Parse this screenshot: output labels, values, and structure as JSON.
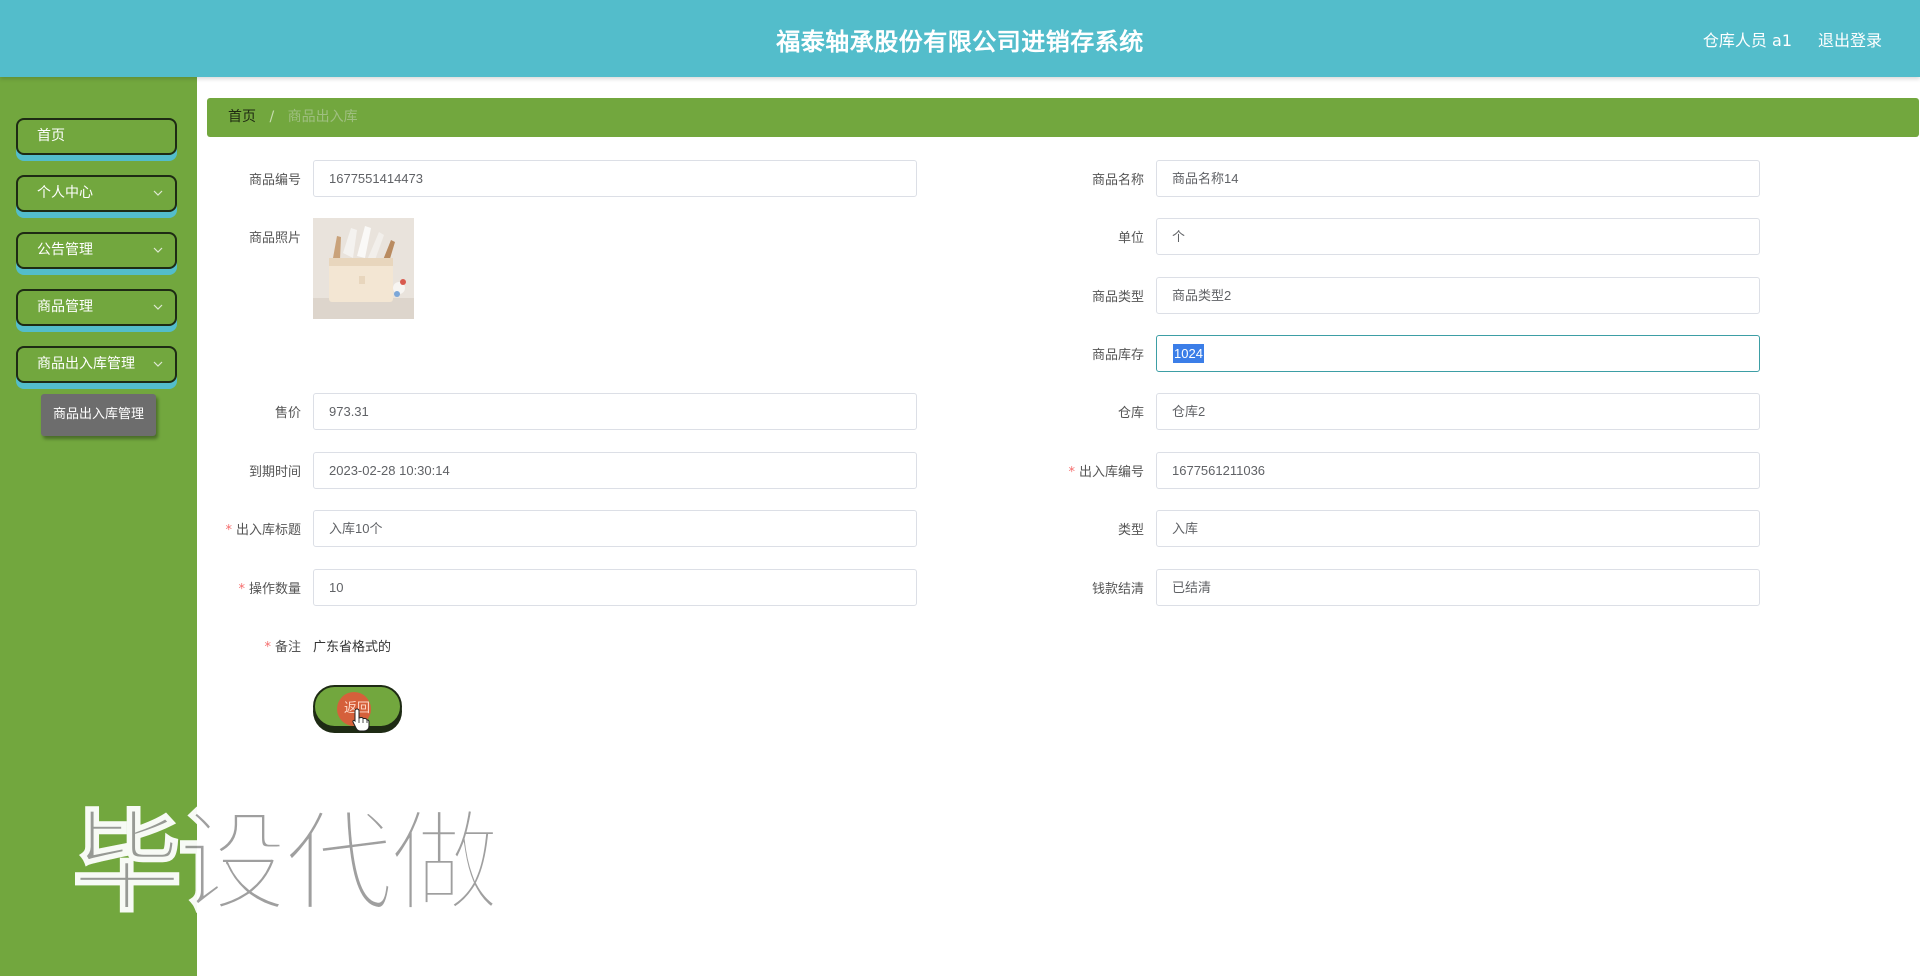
{
  "header": {
    "title": "福泰轴承股份有限公司进销存系统",
    "user": "仓库人员 a1",
    "logout": "退出登录"
  },
  "sidebar": {
    "items": [
      {
        "label": "首页",
        "has_arrow": false
      },
      {
        "label": "个人中心",
        "has_arrow": true
      },
      {
        "label": "公告管理",
        "has_arrow": true
      },
      {
        "label": "商品管理",
        "has_arrow": true
      },
      {
        "label": "商品出入库管理",
        "has_arrow": true
      }
    ],
    "subitem": "商品出入库管理"
  },
  "breadcrumb": {
    "home": "首页",
    "separator": "/",
    "current": "商品出入库"
  },
  "form": {
    "product_code": {
      "label": "商品编号",
      "value": "1677551414473"
    },
    "product_name": {
      "label": "商品名称",
      "value": "商品名称14"
    },
    "product_photo": {
      "label": "商品照片"
    },
    "unit": {
      "label": "单位",
      "value": "个"
    },
    "product_type": {
      "label": "商品类型",
      "value": "商品类型2"
    },
    "stock": {
      "label": "商品库存",
      "value": "1024"
    },
    "price": {
      "label": "售价",
      "value": "973.31"
    },
    "warehouse": {
      "label": "仓库",
      "value": "仓库2"
    },
    "expiry": {
      "label": "到期时间",
      "value": "2023-02-28 10:30:14"
    },
    "io_code": {
      "label": "出入库编号",
      "value": "1677561211036",
      "required": "*"
    },
    "io_title": {
      "label": "出入库标题",
      "value": "入库10个",
      "required": "*"
    },
    "type": {
      "label": "类型",
      "value": "入库"
    },
    "quantity": {
      "label": "操作数量",
      "value": "10",
      "required": "*"
    },
    "payment": {
      "label": "钱款结清",
      "value": "已结清"
    },
    "remark": {
      "label": "备注",
      "value": "广东省格式的",
      "required": "*"
    }
  },
  "buttons": {
    "back": "返回"
  },
  "watermark": "毕设代做",
  "colors": {
    "header": "#53bdcb",
    "sidebar": "#72a73e",
    "breadcrumb": "#72a73e",
    "required": "#f56c6c",
    "selection": "#3b7ee8"
  }
}
